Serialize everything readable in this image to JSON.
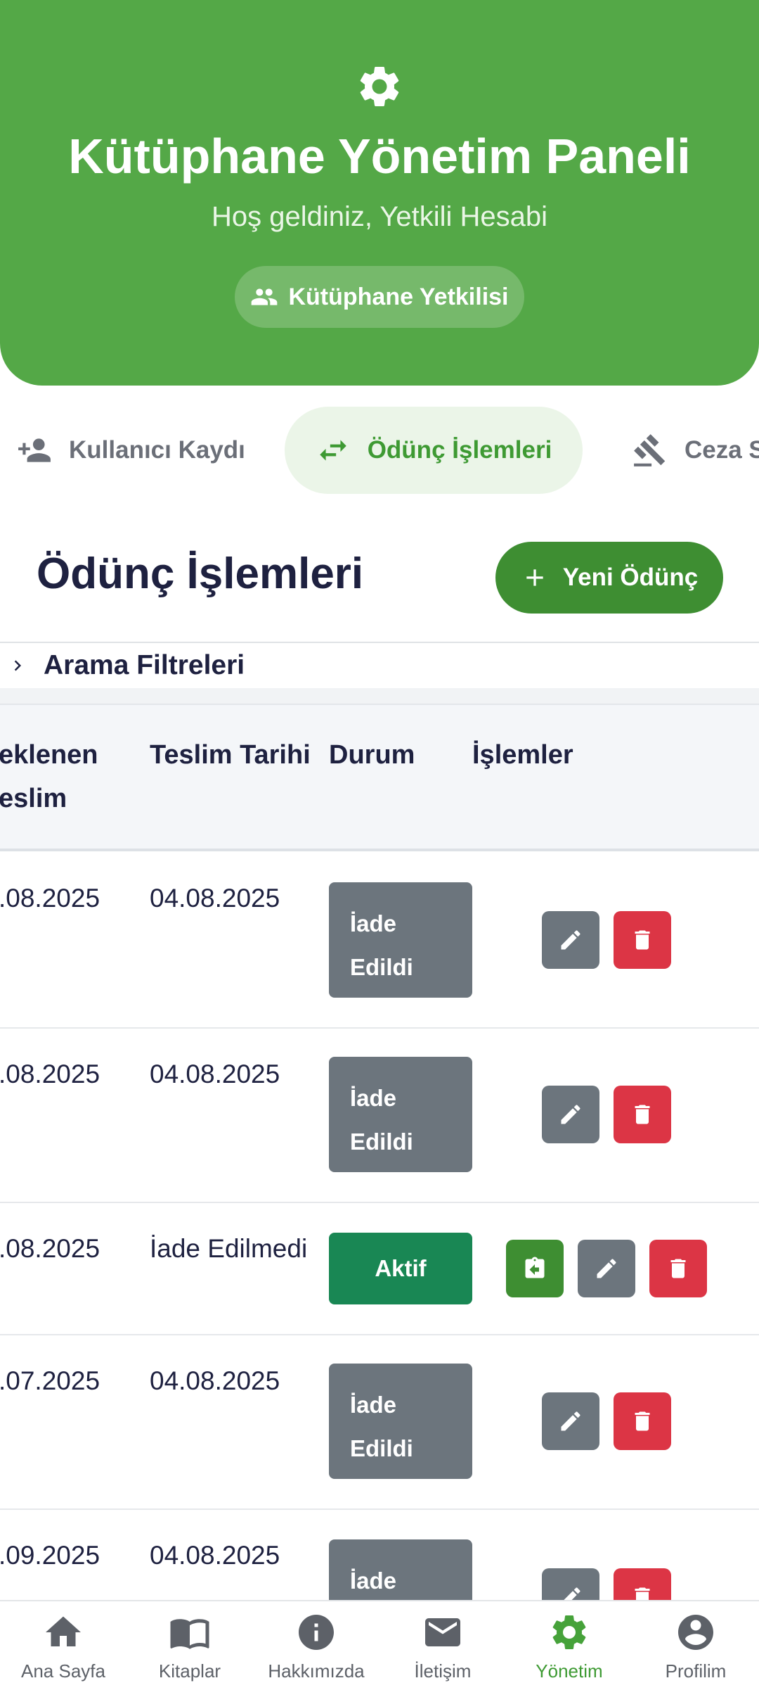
{
  "header": {
    "title": "Kütüphane Yönetim Paneli",
    "welcome": "Hoş geldiniz, Yetkili Hesabi",
    "role": "Kütüphane Yetkilisi",
    "icon": "gear-icon",
    "bg_color": "#54a847"
  },
  "tabs": [
    {
      "label": "Kullanıcı Kaydı",
      "icon": "person-add-icon"
    },
    {
      "label": "Ödünç İşlemleri",
      "icon": "swap-icon",
      "active": true
    },
    {
      "label": "Ceza S",
      "icon": "gavel-icon"
    }
  ],
  "section": {
    "title": "Ödünç İşlemleri",
    "new_button": "Yeni Ödünç"
  },
  "filters": {
    "label": "Arama Filtreleri"
  },
  "table": {
    "headers": {
      "expected_line1": "eklenen",
      "expected_line2": "eslim",
      "delivery": "Teslim Tarihi",
      "status": "Durum",
      "actions": "İşlemler"
    },
    "rows": [
      {
        "expected": ".08.2025",
        "delivered": "04.08.2025",
        "status_l1": "İade",
        "status_l2": "Edildi"
      },
      {
        "expected": ".08.2025",
        "delivered": "04.08.2025",
        "status_l1": "İade",
        "status_l2": "Edildi"
      },
      {
        "expected": ".08.2025",
        "delivered": "İade Edilmedi",
        "status": "Aktif"
      },
      {
        "expected": ".07.2025",
        "delivered": "04.08.2025",
        "status_l1": "İade",
        "status_l2": "Edildi"
      },
      {
        "expected": ".09.2025",
        "delivered": "04.08.2025",
        "status_l1": "İade"
      }
    ],
    "colors": {
      "returned": "#6c757d",
      "active": "#198754",
      "edit": "#6c757d",
      "delete": "#dc3545",
      "return": "#3e8e32"
    }
  },
  "bottom_nav": [
    {
      "label": "Ana Sayfa",
      "icon": "home-icon"
    },
    {
      "label": "Kitaplar",
      "icon": "book-icon"
    },
    {
      "label": "Hakkımızda",
      "icon": "info-icon"
    },
    {
      "label": "İletişim",
      "icon": "mail-icon"
    },
    {
      "label": "Yönetim",
      "icon": "gear-icon",
      "active": true
    },
    {
      "label": "Profilim",
      "icon": "account-icon"
    }
  ]
}
